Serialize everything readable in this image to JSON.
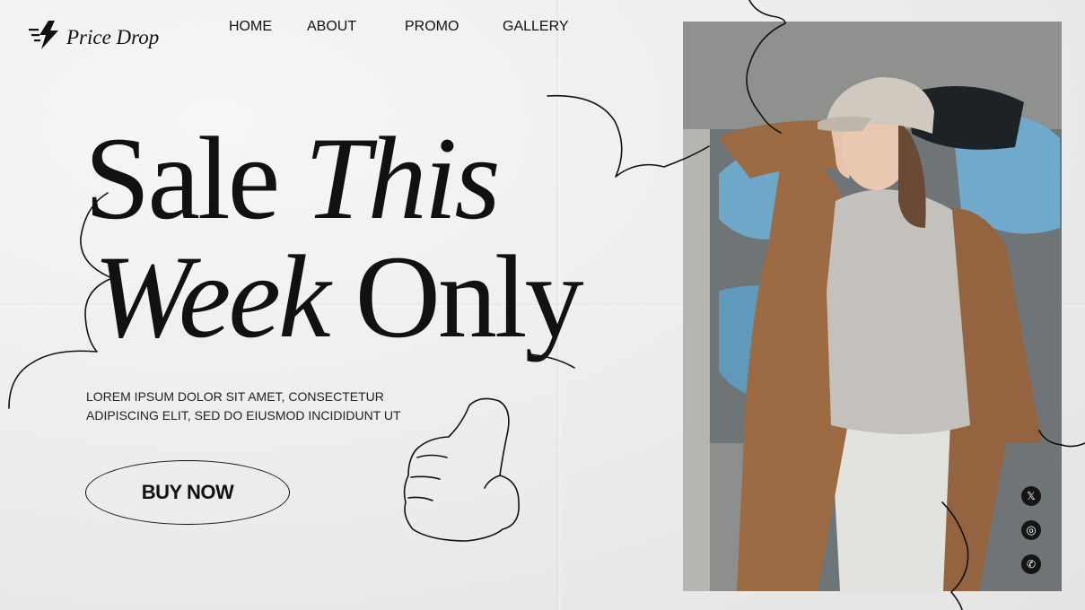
{
  "brand": {
    "name": "Price Drop",
    "logo_icon": "lightning-bolt-icon"
  },
  "nav": {
    "items": [
      {
        "label": "HOME"
      },
      {
        "label": "ABOUT"
      },
      {
        "label": "PROMO"
      },
      {
        "label": "GALLERY"
      }
    ]
  },
  "hero": {
    "word1": "Sale",
    "word2": "This",
    "word3": "Week",
    "word4": "Only",
    "description": "LOREM IPSUM DOLOR SIT AMET, CONSECTETUR ADIPISCING ELIT, SED DO EIUSMOD INCIDIDUNT UT",
    "cta_label": "BUY NOW"
  },
  "social": [
    {
      "icon": "x-twitter-icon",
      "glyph": "𝕏"
    },
    {
      "icon": "instagram-icon",
      "glyph": "◎"
    },
    {
      "icon": "whatsapp-icon",
      "glyph": "✆"
    }
  ],
  "colors": {
    "background": "#eeeeee",
    "ink": "#111111",
    "coat": "#9a6a43",
    "hoodie": "#c4c0bb"
  }
}
